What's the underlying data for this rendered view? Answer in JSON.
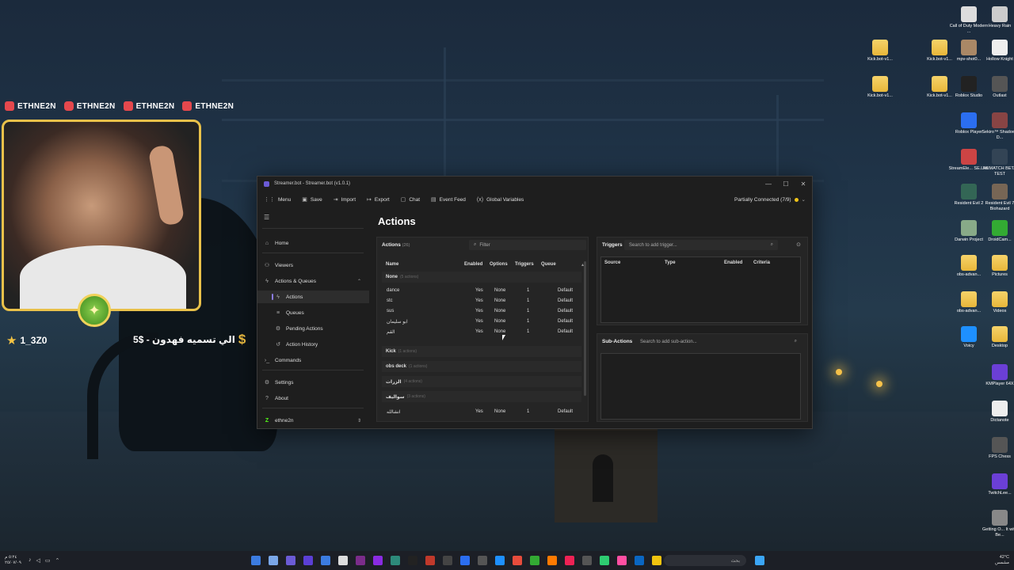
{
  "overlay": {
    "socials": [
      "ETHNE2N",
      "ETHNE2N",
      "ETHNE2N",
      "ETHNE2N"
    ],
    "follower": "1_3Z0",
    "donation": "الي تسميه فهدون - $5"
  },
  "desktop_icons": [
    "Call of Duty Modern ...",
    "Heavy Rain",
    "Kick.bot-v1...",
    "Kick.bot-v1...",
    "mpv-shot0...",
    "Hollow Knight",
    "Kick.bot-v1...",
    "Kick.bot-v1...",
    "Roblox Studio",
    "Outlast",
    "Roblox Player",
    "Sekiro™ Shadows D...",
    "StreamEle... SE.Live",
    "REMATCH BETA TEST",
    "Resident Evil 2",
    "Resident Evil 7 Biohazard",
    "Darwin Project",
    "DroidCam...",
    "obs-advan...",
    "Pictures",
    "obs-advan...",
    "Videos",
    "Voicy",
    "Desktop",
    "KMPlayer 64X",
    "Dictanote",
    "FPS Chess",
    "TwitchLee...",
    "Getting O... It with Be..."
  ],
  "window": {
    "title": "Streamer.bot - Streamer.bot (v1.0.1)",
    "toolbar": {
      "menu": "Menu",
      "save": "Save",
      "import": "Import",
      "export": "Export",
      "chat": "Chat",
      "event_feed": "Event Feed",
      "global_variables": "Global Variables",
      "status": "Partially Connected (7/9)"
    },
    "sidebar": {
      "home": "Home",
      "viewers": "Viewers",
      "actions_queues": "Actions & Queues",
      "actions": "Actions",
      "queues": "Queues",
      "pending_actions": "Pending Actions",
      "action_history": "Action History",
      "commands": "Commands",
      "settings": "Settings",
      "about": "About",
      "user": "ethne2n"
    },
    "page_title": "Actions",
    "actions_panel": {
      "title": "Actions",
      "count": "(26)",
      "filter_placeholder": "Filter",
      "columns": [
        "Name",
        "Enabled",
        "Options",
        "Triggers",
        "Queue"
      ],
      "groups": [
        {
          "name": "None",
          "count": "(5 actions)"
        },
        {
          "name": "Kick",
          "count": "(1 actions)"
        },
        {
          "name": "obs deck",
          "count": "(1 actions)"
        },
        {
          "name": "الزرات",
          "count": "(4 actions)"
        },
        {
          "name": "سواليف",
          "count": "(3 actions)"
        }
      ],
      "rows": [
        {
          "name": "dance",
          "enabled": "Yes",
          "options": "None",
          "triggers": "1",
          "queue": "Default"
        },
        {
          "name": "stc",
          "enabled": "Yes",
          "options": "None",
          "triggers": "1",
          "queue": "Default"
        },
        {
          "name": "sus",
          "enabled": "Yes",
          "options": "None",
          "triggers": "1",
          "queue": "Default"
        },
        {
          "name": "ابو سليمان",
          "enabled": "Yes",
          "options": "None",
          "triggers": "1",
          "queue": "Default"
        },
        {
          "name": "القم",
          "enabled": "Yes",
          "options": "None",
          "triggers": "1",
          "queue": "Default"
        }
      ],
      "partial_row": {
        "name": "انشالله",
        "enabled": "Yes",
        "options": "None",
        "triggers": "1",
        "queue": "Default"
      }
    },
    "triggers_panel": {
      "title": "Triggers",
      "search_placeholder": "Search to add trigger...",
      "columns": [
        "Source",
        "Type",
        "Enabled",
        "Criteria"
      ]
    },
    "subactions_panel": {
      "title": "Sub-Actions",
      "search_placeholder": "Search to add sub-action..."
    }
  },
  "taskbar": {
    "search_placeholder": "بحث",
    "clock": "٥:٢٤ م\n٢٥/٠٧/٠٩",
    "weather": "42°C\nمشمس"
  }
}
